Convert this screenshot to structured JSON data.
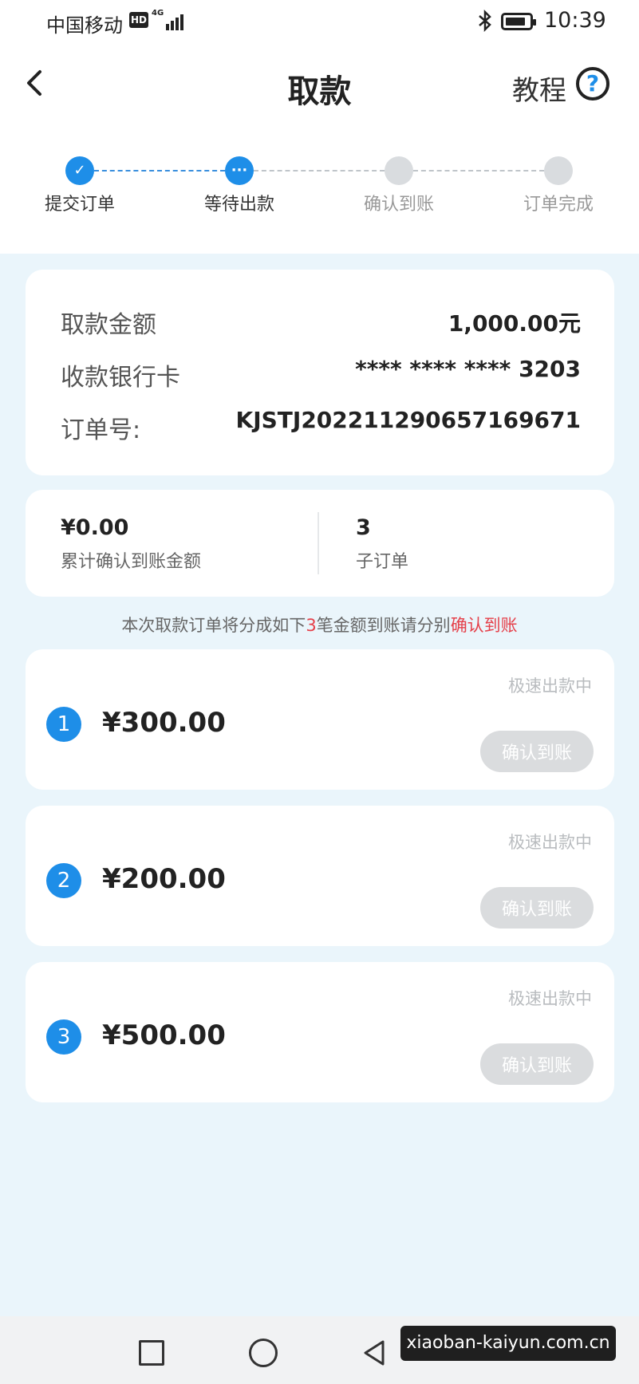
{
  "status_bar": {
    "carrier": "中国移动",
    "hd": "HD",
    "network": "4G",
    "time": "10:39",
    "icons": [
      "signal-icon",
      "bluetooth-icon",
      "battery-icon"
    ]
  },
  "header": {
    "title": "取款",
    "tutorial_label": "教程",
    "help_symbol": "?"
  },
  "steps": [
    {
      "label": "提交订单",
      "state": "done",
      "symbol": "✓"
    },
    {
      "label": "等待出款",
      "state": "active",
      "symbol": "···"
    },
    {
      "label": "确认到账",
      "state": "pending",
      "symbol": ""
    },
    {
      "label": "订单完成",
      "state": "pending",
      "symbol": ""
    }
  ],
  "info": {
    "amount_label": "取款金额",
    "amount_value": "1,000.00元",
    "card_label": "收款银行卡",
    "card_value": "**** **** **** 3203",
    "order_label": "订单号:",
    "order_value": "KJSTJ202211290657169671"
  },
  "summary": {
    "confirmed_value": "¥0.00",
    "confirmed_label": "累计确认到账金额",
    "sub_orders_value": "3",
    "sub_orders_label": "子订单"
  },
  "note": {
    "prefix": "本次取款订单将分成如下",
    "count": "3",
    "middle": "笔金额到账请分别",
    "action": "确认到账"
  },
  "items": [
    {
      "index": "1",
      "amount": "¥300.00",
      "status": "极速出款中",
      "button": "确认到账"
    },
    {
      "index": "2",
      "amount": "¥200.00",
      "status": "极速出款中",
      "button": "确认到账"
    },
    {
      "index": "3",
      "amount": "¥500.00",
      "status": "极速出款中",
      "button": "确认到账"
    }
  ],
  "watermark": "xiaoban-kaiyun.com.cn",
  "colors": {
    "accent": "#1e8ee8",
    "highlight": "#e5404a",
    "background": "#eaf5fb",
    "disabled_button": "#dadcde"
  }
}
